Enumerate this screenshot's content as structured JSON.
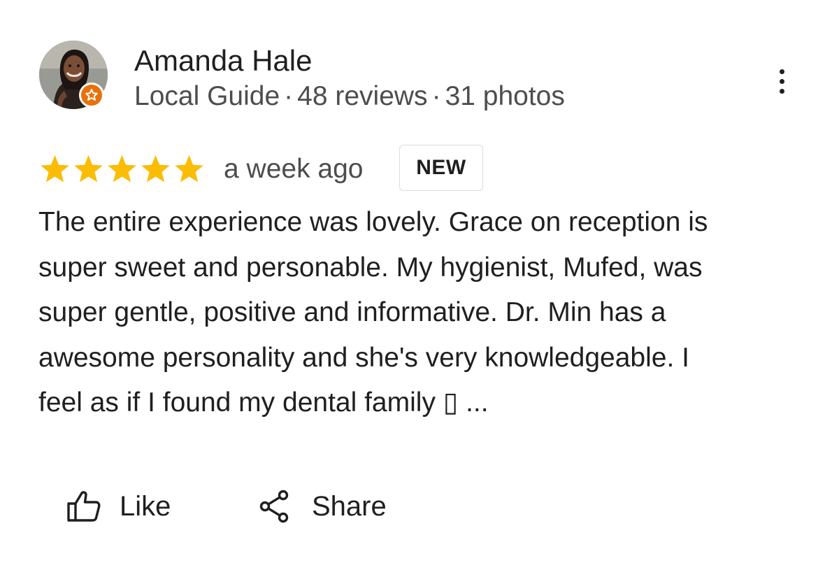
{
  "author": {
    "name": "Amanda Hale",
    "role": "Local Guide",
    "reviews": "48 reviews",
    "photos": "31 photos",
    "separator": "·",
    "avatar_icon": "user-photo",
    "badge_icon": "local-guide-star-icon",
    "badge_color": "#e8710a"
  },
  "menu": {
    "icon": "more-vert-icon"
  },
  "review": {
    "rating": 5,
    "rating_max": 5,
    "star_color": "#fbbc04",
    "time": "a week ago",
    "badge": "NEW",
    "lines": [
      "The entire experience was lovely. Grace on reception is",
      "super sweet and personable. My hygienist, Mufed, was",
      "super gentle, positive and informative. Dr. Min has a",
      "awesome personality and she's very knowledgeable. I",
      "feel as if I found my dental family ▯ ..."
    ]
  },
  "actions": {
    "like_label": "Like",
    "like_icon": "thumb-up-icon",
    "share_label": "Share",
    "share_icon": "share-icon"
  }
}
